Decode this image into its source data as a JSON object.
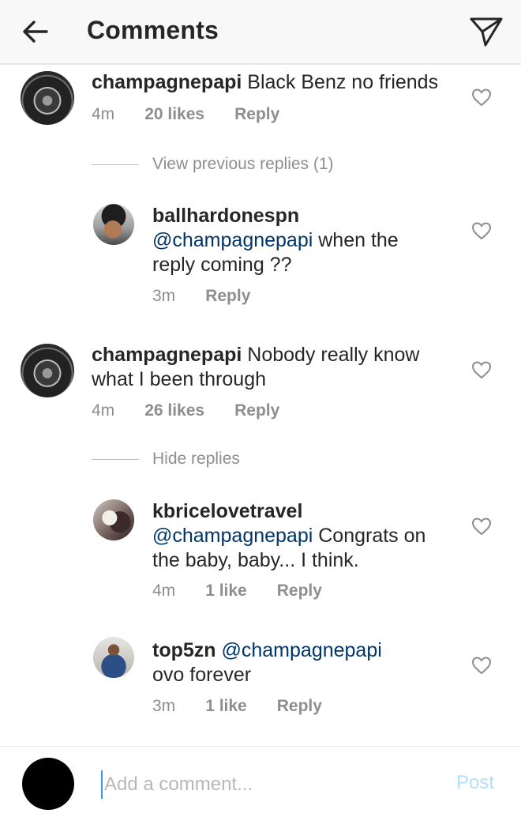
{
  "header": {
    "title": "Comments",
    "back_icon": "arrow-left-icon",
    "send_icon": "paper-plane-icon"
  },
  "comments": [
    {
      "username": "champagnepapi",
      "text": "Black Benz no friends",
      "time": "4m",
      "likes": "20 likes",
      "reply": "Reply",
      "replies_toggle": "View previous replies (1)",
      "replies": [
        {
          "username": "ballhardonespn",
          "mention": "@champagnepapi",
          "text": " when the reply coming ??",
          "time": "3m",
          "reply": "Reply"
        }
      ]
    },
    {
      "username": "champagnepapi",
      "text": "Nobody really know what I been through",
      "time": "4m",
      "likes": "26 likes",
      "reply": "Reply",
      "replies_toggle": "Hide replies",
      "replies": [
        {
          "username": "kbricelovetravel",
          "mention": "@champagnepapi",
          "text": " Congrats on the baby,  baby... I think.",
          "time": "4m",
          "likes": "1 like",
          "reply": "Reply"
        },
        {
          "username": "top5zn",
          "mention": "@champagnepapi",
          "text": "ovo forever",
          "time": "3m",
          "likes": "1 like",
          "reply": "Reply"
        }
      ]
    }
  ],
  "footer": {
    "placeholder": "Add a comment...",
    "post_label": "Post"
  },
  "colors": {
    "mention": "#003569",
    "muted": "#8e8e8e",
    "post_disabled": "#b2dffc"
  }
}
